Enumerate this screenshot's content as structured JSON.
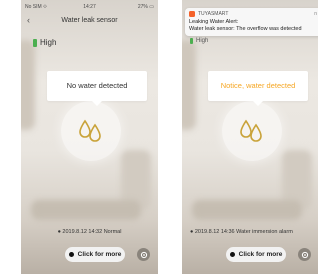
{
  "left_screen": {
    "status": {
      "carrier": "No SIM ⟐",
      "time": "14:27",
      "battery": "27% ▭"
    },
    "nav": {
      "title": "Water leak sensor",
      "back_glyph": "‹"
    },
    "battery_level": "High",
    "message": "No water detected",
    "footer": "● 2019.8.12 14:32 Normal",
    "more_button": "Click for more"
  },
  "right_screen": {
    "notification": {
      "app": "TUYASMART",
      "time": "n",
      "title": "Leaking Water Alert:",
      "body": "Water leak sensor: The overflow was detected"
    },
    "battery_level": "High",
    "message": "Notice, water detected",
    "footer": "● 2019.8.12 14:36 Water immersion alarm",
    "more_button": "Click for more"
  },
  "colors": {
    "battery_green": "#4caf50",
    "alert_orange": "#f5a623",
    "drop_gold": "#c9a33a",
    "app_icon": "#f5622a"
  },
  "icons": [
    "battery-icon",
    "water-drops-icon",
    "settings-icon",
    "back-icon",
    "tuya-app-icon"
  ]
}
